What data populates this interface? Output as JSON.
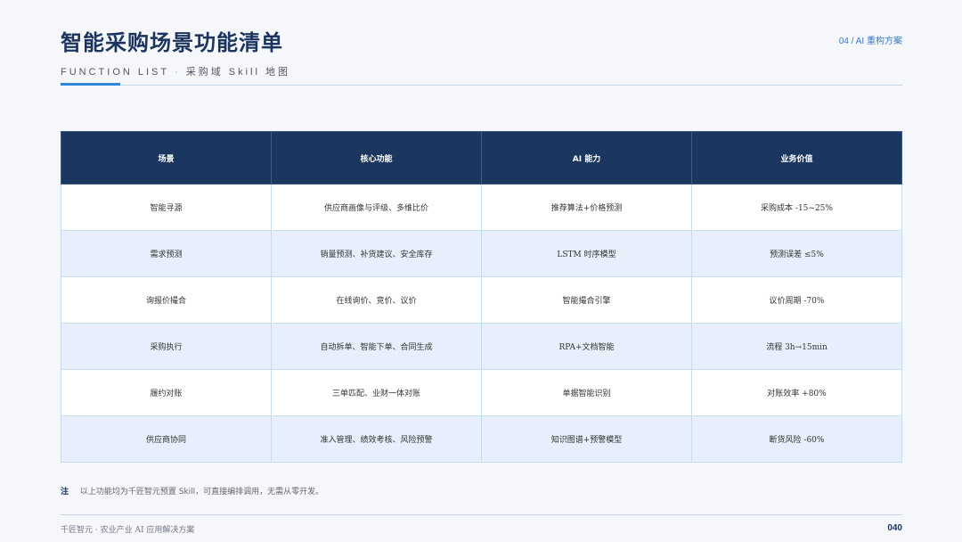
{
  "header": {
    "title": "智能采购场景功能清单",
    "section_tag": "04 / AI 重构方案",
    "subtitle_en": "FUNCTION LIST",
    "subtitle_sep": "·",
    "subtitle_cn": "采购域 Skill 地图"
  },
  "table": {
    "columns": [
      "场景",
      "核心功能",
      "AI 能力",
      "业务价值"
    ],
    "rows": [
      [
        "智能寻源",
        "供应商画像与评级、多维比价",
        "推荐算法+价格预测",
        "采购成本 -15~25%"
      ],
      [
        "需求预测",
        "销量预测、补货建议、安全库存",
        "LSTM 时序模型",
        "预测误差 ≤5%"
      ],
      [
        "询报价撮合",
        "在线询价、竞价、议价",
        "智能撮合引擎",
        "议价周期 -70%"
      ],
      [
        "采购执行",
        "自动拆单、智能下单、合同生成",
        "RPA+文档智能",
        "流程 3h→15min"
      ],
      [
        "履约对账",
        "三单匹配、业财一体对账",
        "单据智能识别",
        "对账效率 +80%"
      ],
      [
        "供应商协同",
        "准入管理、绩效考核、风险预警",
        "知识图谱+预警模型",
        "断货风险 -60%"
      ]
    ]
  },
  "note": {
    "label": "注",
    "text": "以上功能均为千匠智元预置 Skill，可直接编排调用，无需从零开发。"
  },
  "footer": {
    "left": "千匠智元 · 农业产业 AI 应用解决方案",
    "page_number": "040"
  }
}
